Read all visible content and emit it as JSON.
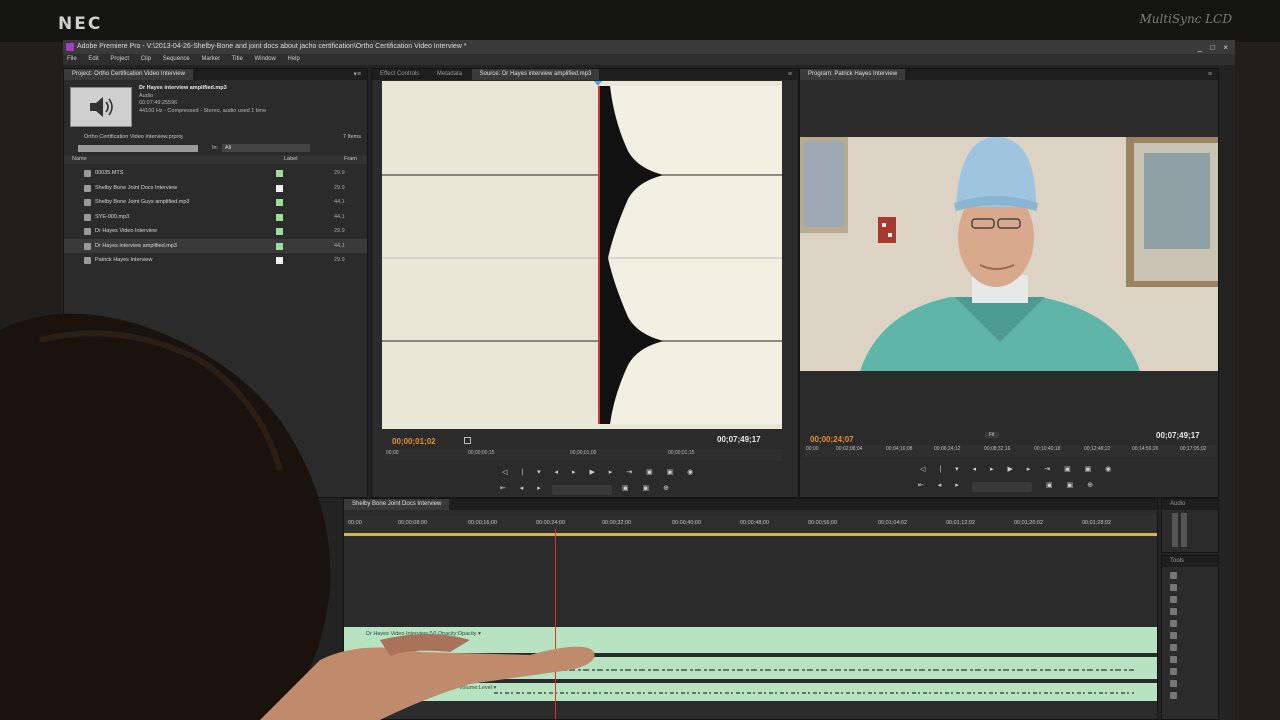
{
  "monitor": {
    "brand": "NEC",
    "model": "MultiSync LCD"
  },
  "window": {
    "title": "Adobe Premiere Pro - V:\\2013-04-26-Shelby-Bone and joint docs about jacho certification\\Ortho Certification Video Interview *",
    "controls": "_ □ ×"
  },
  "menu": [
    "File",
    "Edit",
    "Project",
    "Clip",
    "Sequence",
    "Marker",
    "Title",
    "Window",
    "Help"
  ],
  "project": {
    "tab": "Project: Ortho Certification Video Interview",
    "clip": {
      "name": "Dr Hayes interview amplified.mp3",
      "type": "Audio",
      "duration": "00:07:49:25596",
      "format": "44100 Hz - Compressed - Stereo",
      "usage": ", audio used 1 time"
    },
    "project_file": "Ortho Certification Video Interview.prproj",
    "item_count": "7 Items",
    "in_label": "In:",
    "in_value": "All",
    "columns": {
      "name": "Name",
      "label": "Label",
      "rate": "Fram"
    },
    "items": [
      {
        "name": "00035.MTS",
        "rate": "29.9",
        "label_color": "#9fdc9a"
      },
      {
        "name": "Shelby Bone Joint Docs Interview",
        "rate": "29.9",
        "label_color": "#f2f2f2"
      },
      {
        "name": "Shelby Bone Joint Guys amplified.mp3",
        "rate": "44,1",
        "label_color": "#9fdc9a"
      },
      {
        "name": "SYE-000.mp3",
        "rate": "44,1",
        "label_color": "#9fdc9a"
      },
      {
        "name": "Dr Hayes Video Interview",
        "rate": "29.9",
        "label_color": "#9fdc9a"
      },
      {
        "name": "Dr Hayes interview amplified.mp3",
        "rate": "44,1",
        "label_color": "#9fdc9a"
      },
      {
        "name": "Patrick Hayes Interview",
        "rate": "29.9",
        "label_color": "#f2f2f2"
      }
    ]
  },
  "source": {
    "tabs": [
      "Effect Controls",
      "Metadata",
      "Source: Dr Hayes interview amplified.mp3"
    ],
    "timecode_current": "00;00;01;02",
    "timecode_duration": "00;07;49;17",
    "ruler": [
      "00;00",
      "00;00;00;15",
      "00;00;01;00",
      "00;00;01;15",
      "00;00;02;00"
    ]
  },
  "program": {
    "tab": "Program: Patrick Hayes Interview",
    "timecode_current": "00;00;24;07",
    "timecode_duration": "00;07;49;17",
    "zoom": "Fit",
    "ruler": [
      "00;00",
      "00;02;08;04",
      "00;04;16;08",
      "00;06;24;12",
      "00;08;32;16",
      "00;10;40;18",
      "00;12;48;22",
      "00;14;56;26",
      "00;17;05;02"
    ]
  },
  "timeline": {
    "tab": "Shelby Bone Joint Docs Interview",
    "ruler": [
      "00;00",
      "00;00;08;00",
      "00;00;16;00",
      "00;00;24;00",
      "00;00;32;00",
      "00;00;40;00",
      "00;00;48;00",
      "00;00;56;00",
      "00;01;04;02",
      "00;01;12;02",
      "00;01;20;02",
      "00;01;28;02"
    ],
    "video_clip_label": "Dr Hayes Video Interview [V]  Opacity:Opacity ▾",
    "audio_clip_label": "Dr Hayes Video Interview [A]  Volume:Level ▾",
    "audio2_clip_label": "Volume:Level ▾"
  },
  "audio_meter": {
    "label": "Audio"
  },
  "tools": {
    "label": "Tools"
  },
  "colors": {
    "accent_orange": "#e4902a",
    "playhead_red": "#d8322b",
    "clip_green": "#b7e3c2",
    "wave_bg": "#e9e8d8"
  }
}
